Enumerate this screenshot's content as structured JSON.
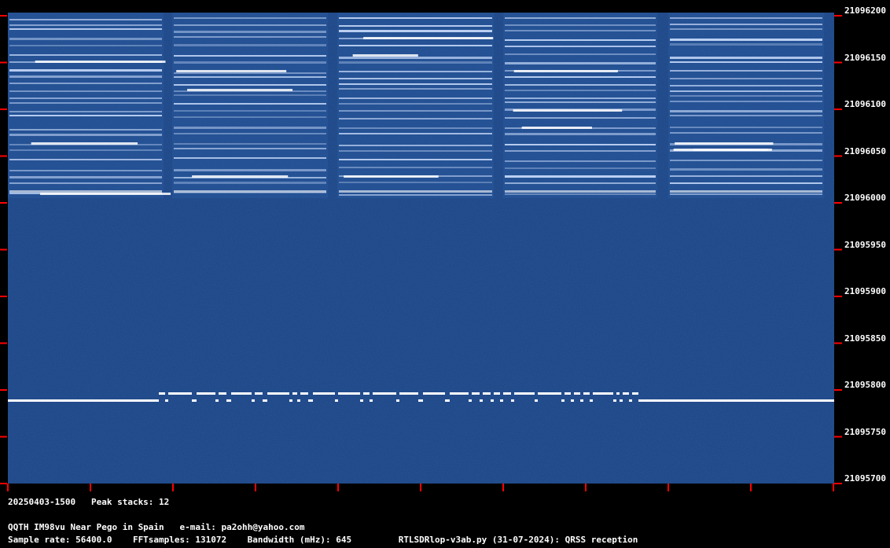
{
  "y_labels": [
    "21096200",
    "21096150",
    "21096100",
    "21096050",
    "21096000",
    "21095950",
    "21095900",
    "21095850",
    "21095800",
    "21095750",
    "21095700"
  ],
  "info": {
    "line1": "20250403-1500   Peak stacks: 12",
    "line2": "QQTH IM98vu Near Pego in Spain   e-mail: pa2ohh@yahoo.com",
    "line3": "Sample rate: 56400.0    FFTsamples: 131072    Bandwidth (mHz): 645         RTLSDRlop-v3ab.py (31-07-2024): QRSS reception"
  },
  "colors": {
    "background": "#1a4384",
    "signal": "#ffffff",
    "tick": "#ff0000"
  }
}
